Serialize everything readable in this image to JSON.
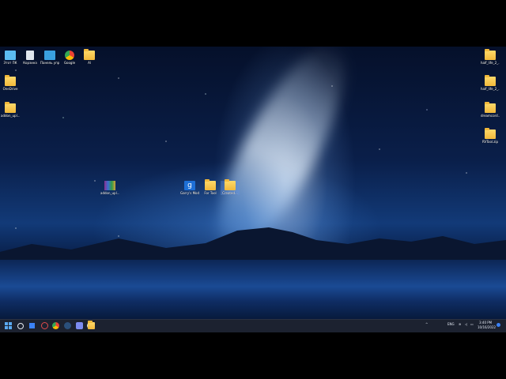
{
  "desktop": {
    "left_icons": [
      {
        "label": "Этот ПК",
        "icon": "this-pc-icon"
      },
      {
        "label": "Корзина",
        "icon": "recycle-bin-icon"
      },
      {
        "label": "Панель управления",
        "icon": "control-panel-icon"
      },
      {
        "label": "Google",
        "icon": "chrome-icon"
      },
      {
        "label": "Al",
        "icon": "folder-icon"
      },
      {
        "label": "OneDrive",
        "icon": "folder-icon"
      },
      {
        "label": "addon_upl...",
        "icon": "folder-icon"
      }
    ],
    "middle_icons": [
      {
        "label": "addon_upl...",
        "icon": "winrar-archive-icon"
      },
      {
        "label": "Garry's Mod",
        "icon": "garrys-mod-icon"
      },
      {
        "label": "For Tool",
        "icon": "folder-icon"
      },
      {
        "label": "Created...",
        "icon": "folder-icon"
      }
    ],
    "right_icons": [
      {
        "label": "half_life_2_...",
        "icon": "folder-icon"
      },
      {
        "label": "half_life_2_...",
        "icon": "folder-icon"
      },
      {
        "label": "dreamcord...",
        "icon": "folder-icon"
      },
      {
        "label": "RVTool.zip",
        "icon": "folder-icon"
      }
    ]
  },
  "taskbar": {
    "items": [
      "windows-start-icon",
      "search-icon",
      "download-icon",
      "record-icon",
      "chrome-icon",
      "steam-icon",
      "discord-icon",
      "obs-icon",
      "file-explorer-icon"
    ],
    "tray": {
      "language": "ENG",
      "time": "3:40 PM",
      "date": "10/16/2022"
    }
  },
  "colors": {
    "taskbar_bg": "#1c2230",
    "folder": "#f1b93b",
    "accent": "#3b82f6"
  }
}
